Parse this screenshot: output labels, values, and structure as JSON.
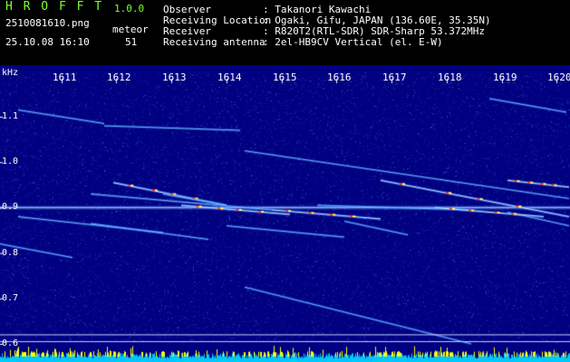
{
  "header": {
    "app_title": "H R O F F T",
    "version": "1.0.0",
    "filename": "2510081610.png",
    "datetime": "25.10.08 16:10",
    "meteor_label": "meteor",
    "meteor_count": "51",
    "info": [
      {
        "label": "Observer",
        "value": ": Takanori Kawachi"
      },
      {
        "label": "Receiving Location",
        "value": ": Ogaki, Gifu, JAPAN (136.60E, 35.35N)"
      },
      {
        "label": "Receiver",
        "value": ": R820T2(RTL-SDR) SDR-Sharp 53.372MHz"
      },
      {
        "label": "Receiving antenna",
        "value": ": 2el-HB9CV Vertical (el. E-W)"
      }
    ]
  },
  "chart_data": {
    "type": "heatmap",
    "title": "",
    "ylabel": "kHz",
    "x_ticks": [
      "1611",
      "1612",
      "1613",
      "1614",
      "1615",
      "1616",
      "1617",
      "1618",
      "1619",
      "1620"
    ],
    "y_ticks": [
      "1.1",
      "1.0",
      "0.9",
      "0.8",
      "0.7",
      "0.6"
    ],
    "ylim": [
      0.58,
      1.2
    ],
    "xlim": [
      1610.6,
      1620.0
    ],
    "carrier_khz": 0.9,
    "reference_lines_khz": [
      0.62,
      0.605
    ],
    "colors": {
      "background": "#000080",
      "noise": "#2a3fd0",
      "weak": "#4aa8ff",
      "strong": "#ffffff",
      "peak": "#ff3030",
      "bar_low": "#00c8ff",
      "bar_high": "#ffff00"
    }
  }
}
